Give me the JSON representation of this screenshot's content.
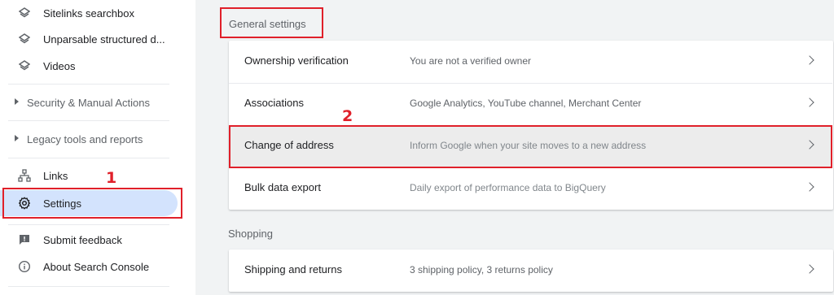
{
  "sidebar": {
    "items_top": [
      {
        "label": "Sitelinks searchbox",
        "icon": "layers-icon"
      },
      {
        "label": "Unparsable structured d...",
        "icon": "layers-icon"
      },
      {
        "label": "Videos",
        "icon": "layers-icon"
      }
    ],
    "sections": [
      {
        "label": "Security & Manual Actions"
      },
      {
        "label": "Legacy tools and reports"
      }
    ],
    "links_label": "Links",
    "settings_label": "Settings",
    "submit_feedback_label": "Submit feedback",
    "about_label": "About Search Console"
  },
  "main": {
    "general_settings_title": "General settings",
    "general_rows": [
      {
        "title": "Ownership verification",
        "desc": "You are not a verified owner"
      },
      {
        "title": "Associations",
        "desc": "Google Analytics, YouTube channel, Merchant Center"
      },
      {
        "title": "Change of address",
        "desc": "Inform Google when your site moves to a new address"
      },
      {
        "title": "Bulk data export",
        "desc": "Daily export of performance data to BigQuery"
      }
    ],
    "shopping_title": "Shopping",
    "shopping_rows": [
      {
        "title": "Shipping and returns",
        "desc": "3 shipping policy, 3 returns policy"
      }
    ]
  },
  "annotations": {
    "step1": "1",
    "step2": "2"
  },
  "colors": {
    "accent_active": "#d3e3fd",
    "annotation_red": "#e0202a"
  }
}
